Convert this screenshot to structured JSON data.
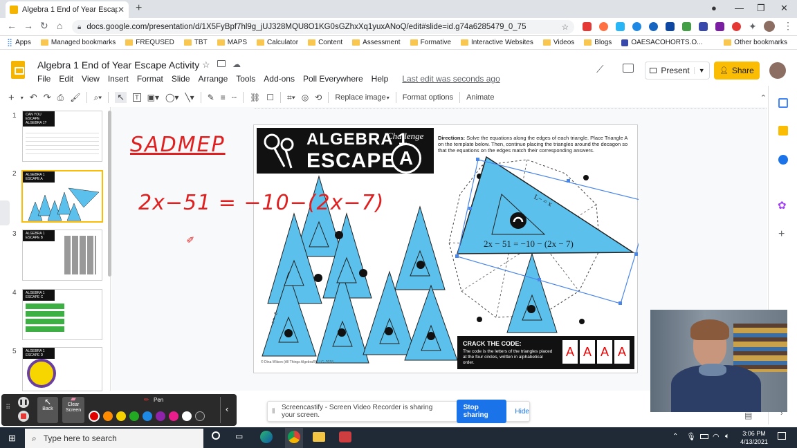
{
  "browser": {
    "tab_title": "Algebra 1 End of Year Escape Act",
    "url": "docs.google.com/presentation/d/1X5FyBpf7hl9g_jUJ328MQU8O1KG0sGZhxXq1yuxANoQ/edit#slide=id.g74a6285479_0_75",
    "bookmarks": [
      "Apps",
      "Managed bookmarks",
      "FREQUSED",
      "TBT",
      "MAPS",
      "Calculator",
      "Content",
      "Assessment",
      "Formative",
      "Interactive Websites",
      "Videos",
      "Blogs",
      "OAESACOHORTS.O...",
      "Other bookmarks"
    ]
  },
  "app": {
    "doc_title": "Algebra 1 End of Year Escape Activity",
    "menus": [
      "File",
      "Edit",
      "View",
      "Insert",
      "Format",
      "Slide",
      "Arrange",
      "Tools",
      "Add-ons",
      "Poll Everywhere",
      "Help"
    ],
    "last_edit": "Last edit was seconds ago",
    "present_label": "Present",
    "share_label": "Share",
    "toolbar": {
      "replace_image": "Replace image",
      "format_options": "Format options",
      "animate": "Animate"
    }
  },
  "filmstrip": {
    "slides": [
      {
        "num": "1",
        "caption": "CAN YOU ESCAPE ALGEBRA 1?"
      },
      {
        "num": "2",
        "caption": "ALGEBRA 1 ESCAPE A"
      },
      {
        "num": "3",
        "caption": "ALGEBRA 1 ESCAPE B"
      },
      {
        "num": "4",
        "caption": "ALGEBRA 1 ESCAPE C"
      },
      {
        "num": "5",
        "caption": "ALGEBRA 1 ESCAPE D"
      }
    ],
    "selected": 2
  },
  "slide": {
    "header_line1": "ALGEBRA 1",
    "header_line2": "ESCAPE",
    "challenge": "Challenge",
    "letter": "A",
    "directions_label": "Directions:",
    "directions_text": "Solve the equations along the edges of each triangle. Place Triangle A on the template below. Then, continue placing the triangles around the decagon so that the equations on the edges match their corresponding answers.",
    "equation": "2x − 51 = −10 − (2x − 7)",
    "crack_title": "CRACK THE CODE:",
    "crack_text": "The code is the letters of the triangles placed at the four circles, written in alphabetical order.",
    "code": [
      "A",
      "A",
      "A",
      "A"
    ],
    "triangle_letters": [
      "B",
      "E",
      "F",
      "D",
      "H",
      "I",
      "G",
      "J",
      "A"
    ],
    "copyright": "© Dina Wilson (All Things Algebra®) LLC, 2018",
    "tri_side_text": "x = −2",
    "big_tri_text": "L− = x"
  },
  "annotations": {
    "word": "SADMEP",
    "equation": "2x−51 = −10−(2x−7)"
  },
  "screencastify": {
    "pen_label": "Pen",
    "back_label": "Back",
    "clear_label": "Clear Screen",
    "colors": [
      "#e00000",
      "#ff8c00",
      "#f5d000",
      "#22aa22",
      "#1e88e5",
      "#8e24aa",
      "#e91e8c",
      "#ffffff",
      "#333333"
    ]
  },
  "share_banner": {
    "message": "Screencastify - Screen Video Recorder is sharing your screen.",
    "stop_label": "Stop sharing",
    "hide_label": "Hide"
  },
  "taskbar": {
    "search_placeholder": "Type here to search",
    "time": "3:06 PM",
    "date": "4/13/2021"
  }
}
